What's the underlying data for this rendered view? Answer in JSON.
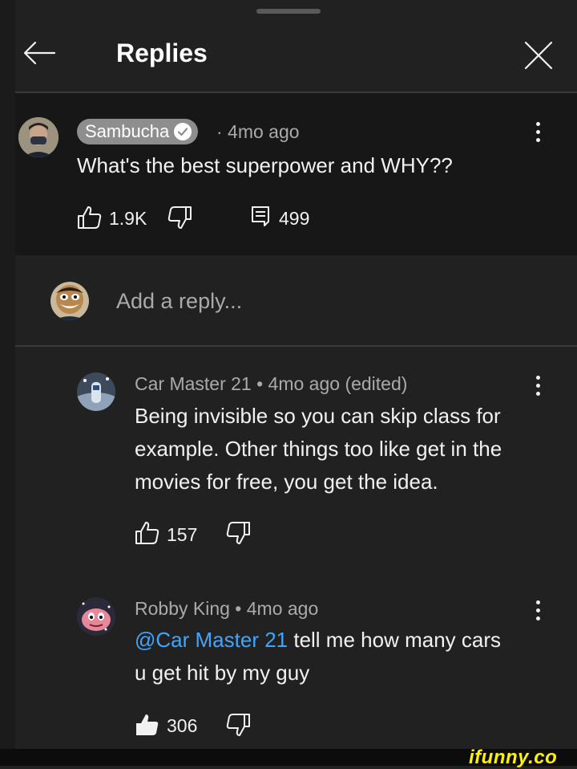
{
  "header": {
    "title": "Replies",
    "back_icon": "arrow-left-icon",
    "close_icon": "close-icon"
  },
  "top_comment": {
    "author": "Sambucha",
    "verified": true,
    "time": "· 4mo ago",
    "text": "What's the best superpower and WHY??",
    "likes": "1.9K",
    "replies": "499"
  },
  "composer": {
    "placeholder": "Add a reply..."
  },
  "replies": [
    {
      "author_time": "Car Master 21 • 4mo ago (edited)",
      "text": "Being invisible so you can skip class for example. Other things too like get in the movies for free, you get the idea.",
      "likes": "157",
      "liked": false
    },
    {
      "author_time": "Robby King • 4mo ago",
      "mention": "@Car Master 21",
      "text": " tell me how many cars u get hit by my guy",
      "likes": "306",
      "liked": true
    }
  ],
  "watermark": "ifunny.co",
  "colors": {
    "background": "#212121",
    "highlight": "#171717",
    "mention": "#3ea6ff",
    "watermark": "#fff200"
  }
}
